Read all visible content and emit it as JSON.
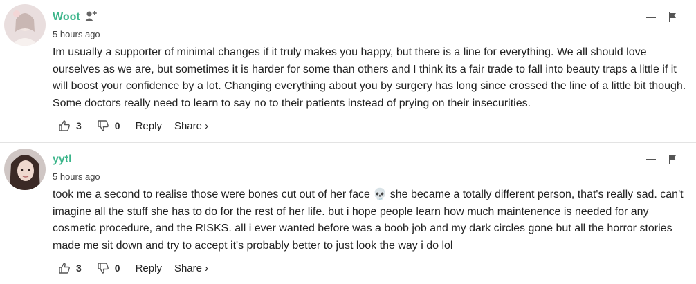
{
  "comments": [
    {
      "username": "Woot",
      "timestamp": "5 hours ago",
      "text": "Im usually a supporter of minimal changes if it truly makes you happy, but there is a line for everything. We all should love ourselves as we are, but sometimes it is harder for some than others and I think its a fair trade to fall into beauty traps a little if it will boost your confidence by a lot. Changing everything about you by surgery has long since crossed the line of a little bit though. Some doctors really need to learn to say no to their patients instead of prying on their insecurities.",
      "upvotes": "3",
      "downvotes": "0",
      "reply_label": "Reply",
      "share_label": "Share ›"
    },
    {
      "username": "yytl",
      "timestamp": "5 hours ago",
      "text": "took me a second to realise those were bones cut out of her face 💀 she became a totally different person, that's really sad. can't imagine all the stuff she has to do for the rest of her life. but i hope people learn how much maintenence is needed for any cosmetic procedure, and the RISKS. all i ever wanted before was a boob job and my dark circles gone but all the horror stories made me sit down and try to accept it's probably better to just look the way i do lol",
      "upvotes": "3",
      "downvotes": "0",
      "reply_label": "Reply",
      "share_label": "Share ›"
    }
  ],
  "icons": {
    "follow": "add-user-icon",
    "collapse": "minus-icon",
    "report": "flag-icon",
    "upvote": "thumbs-up-icon",
    "downvote": "thumbs-down-icon"
  },
  "colors": {
    "username": "#3bb58a",
    "text": "#222222",
    "meta": "#444444"
  }
}
